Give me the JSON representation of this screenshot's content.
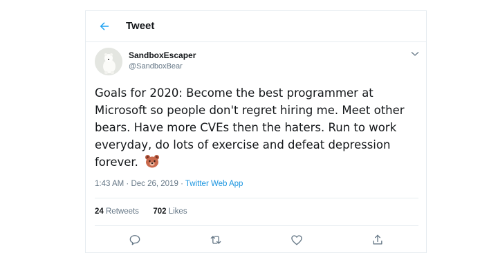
{
  "header": {
    "title": "Tweet",
    "back_icon": "back-arrow-icon"
  },
  "author": {
    "display_name": "SandboxEscaper",
    "handle": "@SandboxBear",
    "avatar_icon": "polar-bear-avatar"
  },
  "tweet": {
    "text": "Goals for 2020: Become the best programmer at Microsoft so people don't regret hiring me. Meet other bears. Have more CVEs then the haters. Run to work everyday, do lots of exercise and defeat depression forever.",
    "emoji": "bear-face-emoji",
    "time": "1:43 AM",
    "separator": "·",
    "date": "Dec 26, 2019",
    "source": "Twitter Web App"
  },
  "stats": {
    "retweets_count": "24",
    "retweets_label": "Retweets",
    "likes_count": "702",
    "likes_label": "Likes"
  },
  "actions": [
    "reply-icon",
    "retweet-icon",
    "like-icon",
    "share-icon"
  ],
  "colors": {
    "accent": "#1da1f2",
    "link": "#1b95e0",
    "secondary_text": "#657786",
    "border": "#e6ecf0"
  }
}
